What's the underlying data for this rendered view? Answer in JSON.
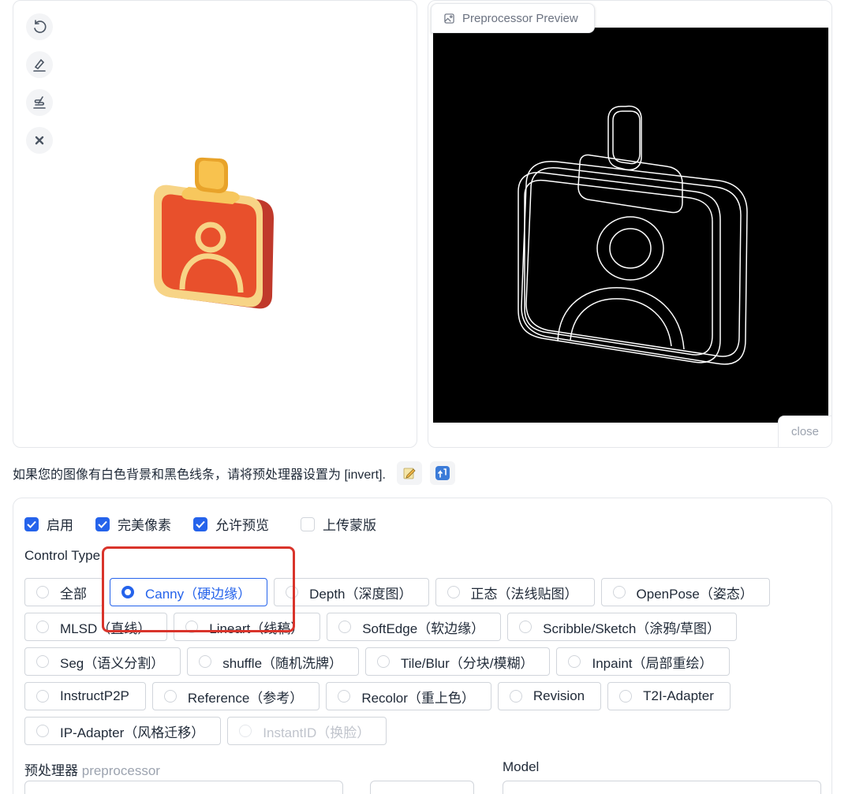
{
  "preview": {
    "tab_label": "Preprocessor Preview",
    "close_label": "close"
  },
  "hint": {
    "text": "如果您的图像有白色背景和黑色线条，请将预处理器设置为 [invert]."
  },
  "checkboxes": [
    {
      "label": "启用",
      "checked": true
    },
    {
      "label": "完美像素",
      "checked": true
    },
    {
      "label": "允许预览",
      "checked": true
    },
    {
      "label": "上传蒙版",
      "checked": false
    }
  ],
  "control_type": {
    "label": "Control Type",
    "options": [
      {
        "label": "全部"
      },
      {
        "label": "Canny（硬边缘）",
        "selected": true
      },
      {
        "label": "Depth（深度图）"
      },
      {
        "label": "正态（法线贴图）"
      },
      {
        "label": "OpenPose（姿态）"
      },
      {
        "label": "MLSD（直线）"
      },
      {
        "label": "Lineart（线稿）"
      },
      {
        "label": "SoftEdge（软边缘）"
      },
      {
        "label": "Scribble/Sketch（涂鸦/草图）"
      },
      {
        "label": "Seg（语义分割）"
      },
      {
        "label": "shuffle（随机洗牌）"
      },
      {
        "label": "Tile/Blur（分块/模糊）"
      },
      {
        "label": "Inpaint（局部重绘）"
      },
      {
        "label": "InstructP2P"
      },
      {
        "label": "Reference（参考）"
      },
      {
        "label": "Recolor（重上色）"
      },
      {
        "label": "Revision"
      },
      {
        "label": "T2I-Adapter"
      },
      {
        "label": "IP-Adapter（风格迁移）"
      },
      {
        "label": "InstantID（换脸）",
        "disabled": true
      }
    ]
  },
  "preprocessor": {
    "label": "预处理器",
    "sub_label": "preprocessor"
  },
  "model": {
    "label": "Model"
  },
  "colors": {
    "accent": "#2563eb",
    "highlight": "#d9342b"
  },
  "icons": [
    "undo-icon",
    "eraser-icon",
    "brush-icon",
    "clear-icon",
    "image-icon",
    "edit-note-icon",
    "transfer-icon"
  ]
}
